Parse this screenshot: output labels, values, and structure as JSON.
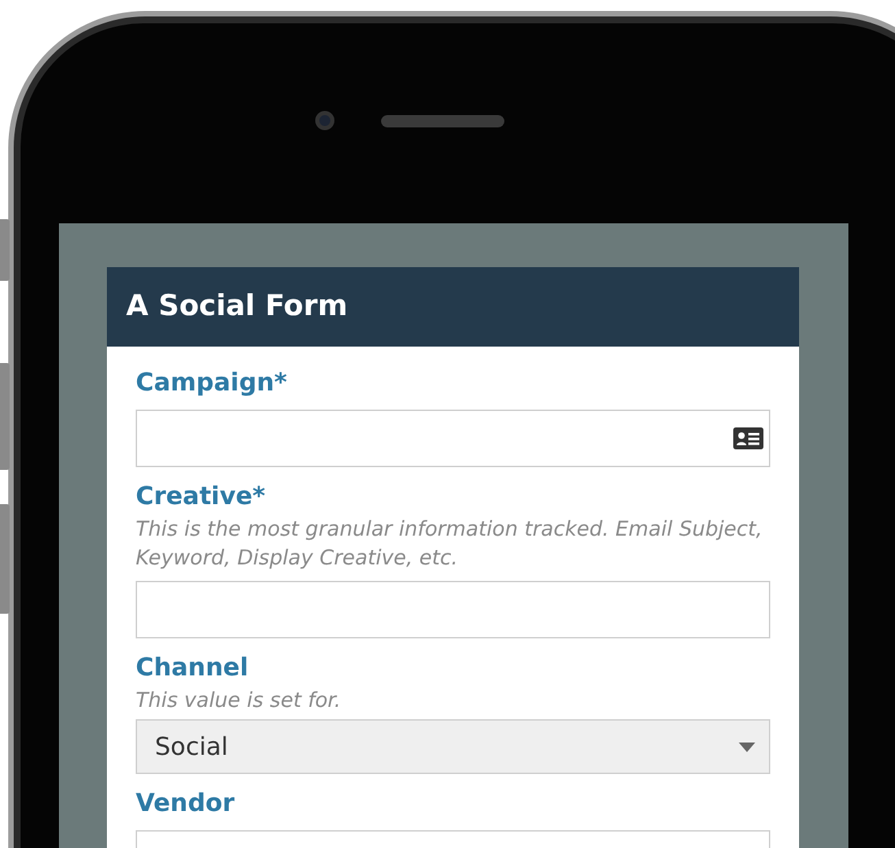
{
  "form": {
    "title": "A Social Form",
    "fields": [
      {
        "kind": "lookup",
        "label": "Campaign*"
      },
      {
        "kind": "text",
        "label": "Creative*",
        "help": "This is the most granular information tracked. Email Subject, Keyword, Display Creative, etc."
      },
      {
        "kind": "select",
        "label": "Channel",
        "help": "This value is set for.",
        "value": "Social"
      },
      {
        "kind": "text",
        "label": "Vendor"
      }
    ]
  }
}
